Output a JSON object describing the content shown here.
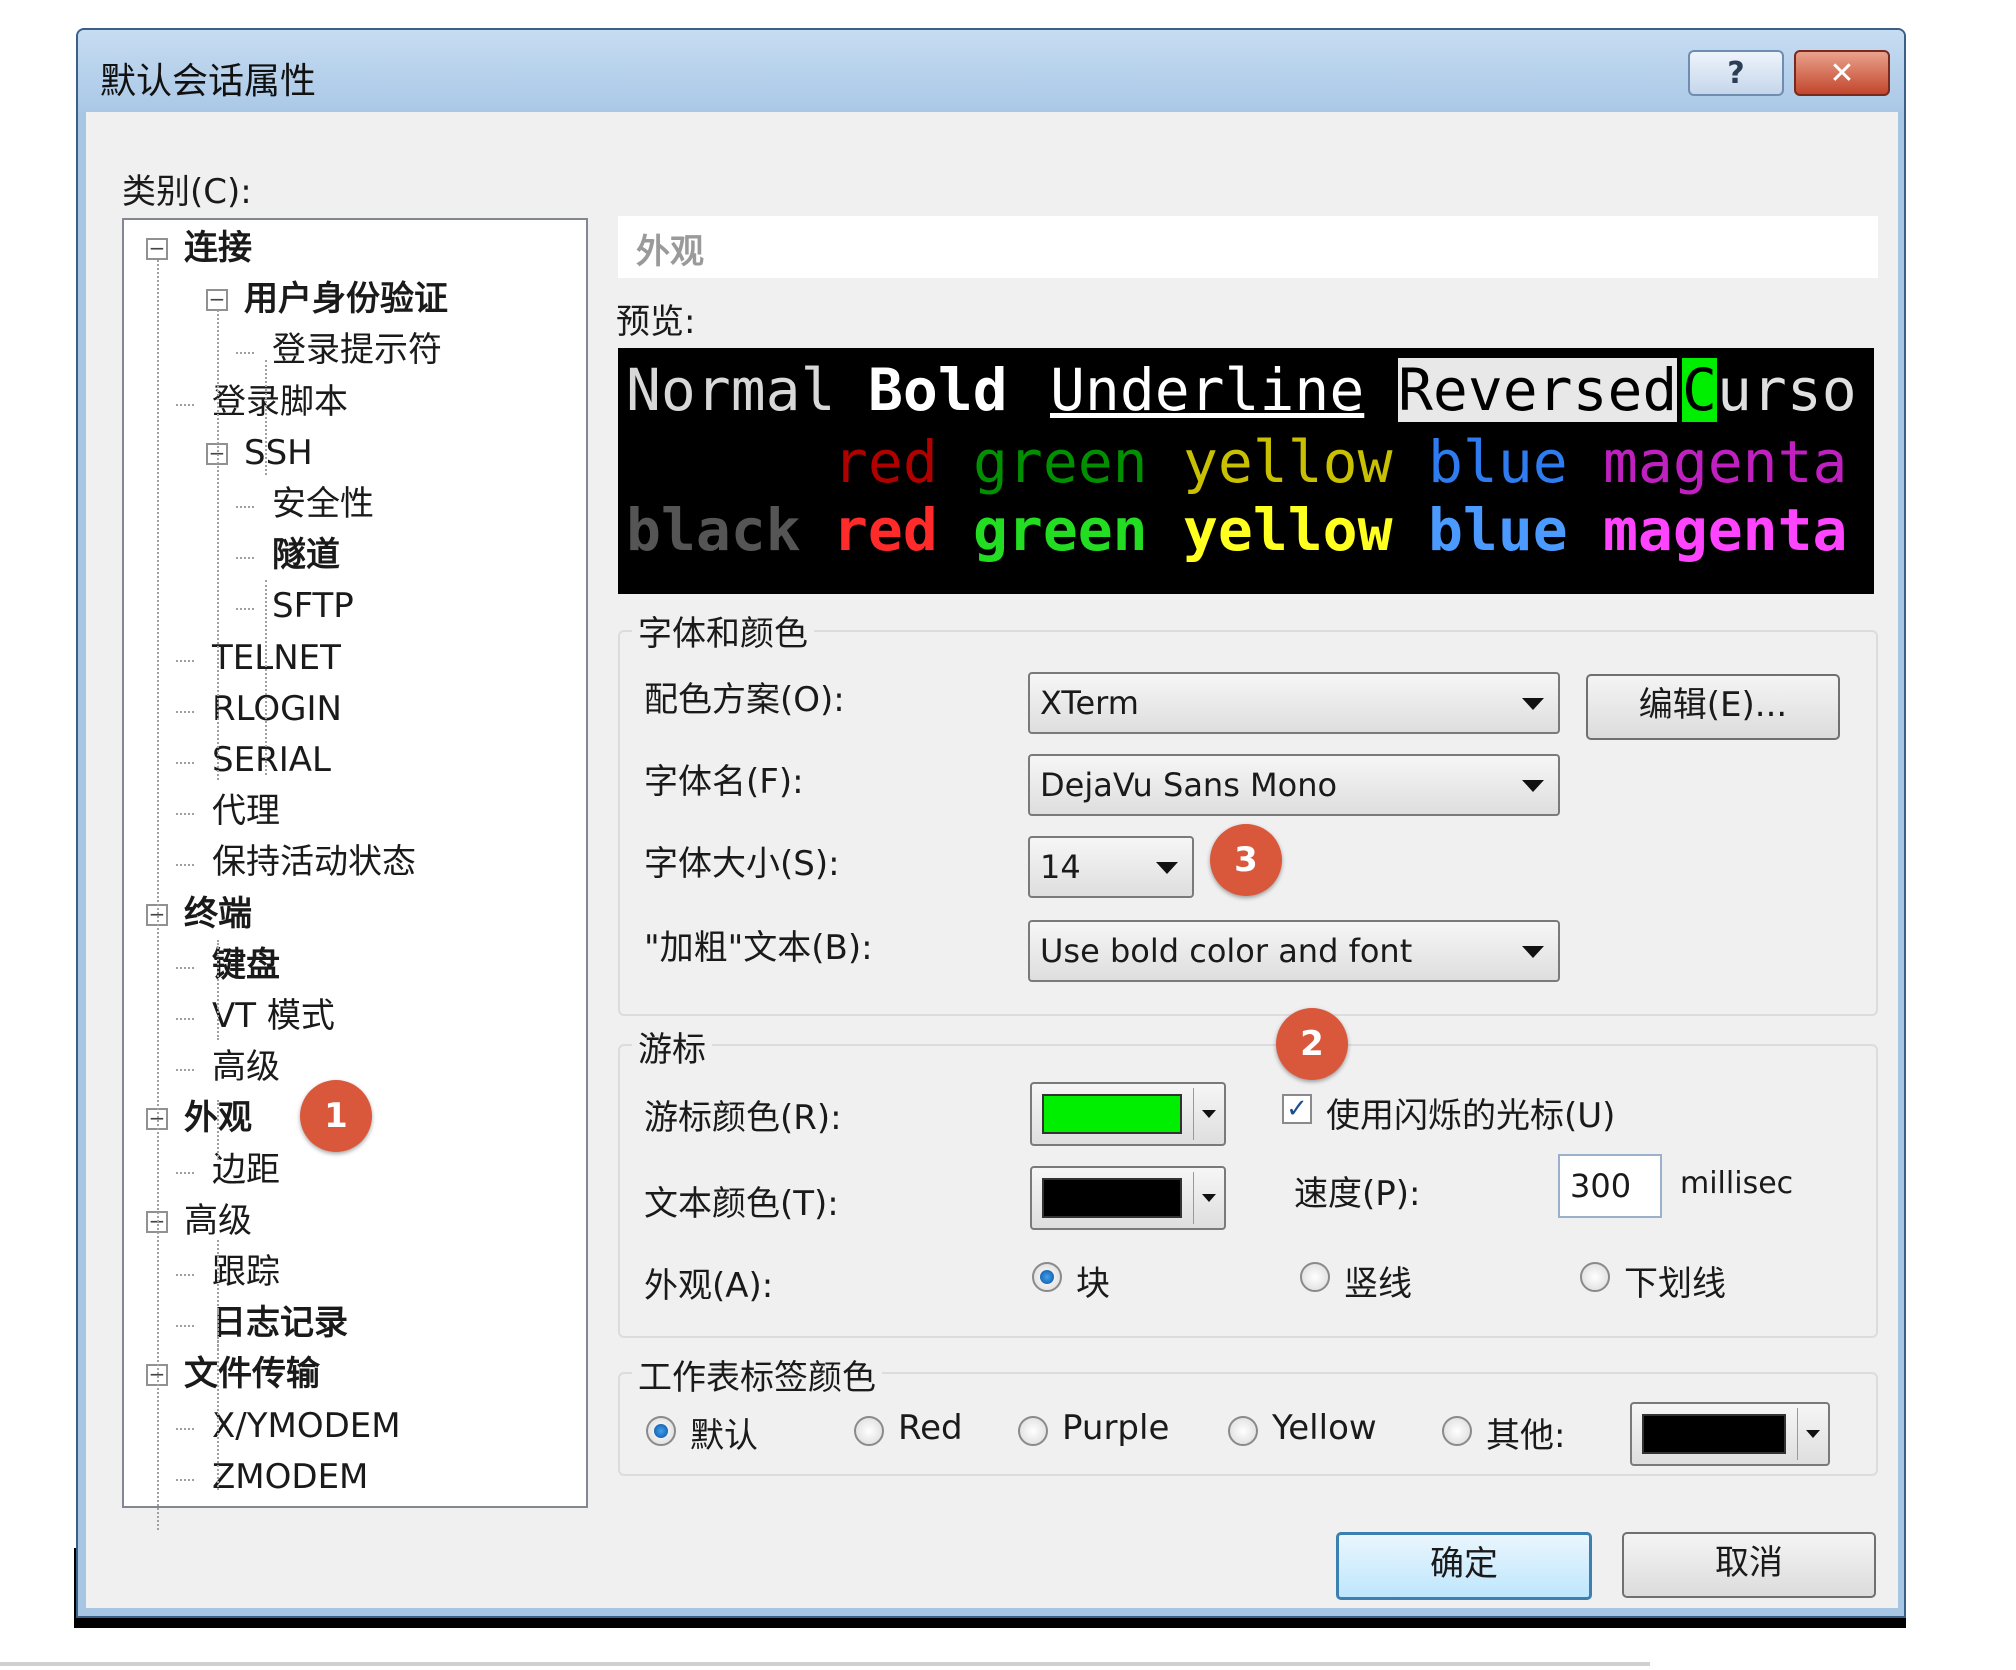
{
  "window": {
    "title": "默认会话属性",
    "help_glyph": "?",
    "close_glyph": "✕"
  },
  "category": {
    "label": "类别(C):",
    "tree": [
      {
        "label": "连接",
        "bold": true,
        "expander": "⊟"
      },
      {
        "label": "用户身份验证",
        "bold": true,
        "expander": "⊟"
      },
      {
        "label": "登录提示符"
      },
      {
        "label": "登录脚本"
      },
      {
        "label": "SSH",
        "expander": "⊟"
      },
      {
        "label": "安全性"
      },
      {
        "label": "隧道",
        "bold": true
      },
      {
        "label": "SFTP"
      },
      {
        "label": "TELNET"
      },
      {
        "label": "RLOGIN"
      },
      {
        "label": "SERIAL"
      },
      {
        "label": "代理"
      },
      {
        "label": "保持活动状态"
      },
      {
        "label": "终端",
        "bold": true,
        "expander": "⊟"
      },
      {
        "label": "键盘",
        "bold": true
      },
      {
        "label": "VT 模式"
      },
      {
        "label": "高级"
      },
      {
        "label": "外观",
        "bold": true,
        "expander": "⊟",
        "selected": true
      },
      {
        "label": "边距"
      },
      {
        "label": "高级",
        "expander": "⊟"
      },
      {
        "label": "跟踪"
      },
      {
        "label": "日志记录",
        "bold": true
      },
      {
        "label": "文件传输",
        "bold": true,
        "expander": "⊟"
      },
      {
        "label": "X/YMODEM"
      },
      {
        "label": "ZMODEM"
      }
    ]
  },
  "page": {
    "title": "外观",
    "preview_label": "预览:",
    "preview": {
      "line1": [
        "Normal",
        "Bold",
        "Underline",
        "Reversed",
        "C",
        "urso"
      ],
      "line2": [
        "red",
        "green",
        "yellow",
        "blue",
        "magenta"
      ],
      "line3": [
        "black",
        "red",
        "green",
        "yellow",
        "blue",
        "magenta"
      ]
    }
  },
  "font_group": {
    "legend": "字体和颜色",
    "scheme_label": "配色方案(O):",
    "scheme_value": "XTerm",
    "edit_button": "编辑(E)...",
    "font_label": "字体名(F):",
    "font_value": "DejaVu Sans Mono",
    "size_label": "字体大小(S):",
    "size_value": "14",
    "bold_label": "\"加粗\"文本(B):",
    "bold_value": "Use bold color and font"
  },
  "cursor_group": {
    "legend": "游标",
    "cursor_color_label": "游标颜色(R):",
    "cursor_color": "#00ee00",
    "text_color_label": "文本颜色(T):",
    "text_color": "#000000",
    "blink_label": "使用闪烁的光标(U)",
    "blink_checked": true,
    "check_glyph": "✓",
    "speed_label": "速度(P):",
    "speed_value": "300",
    "speed_unit": "millisec",
    "appearance_label": "外观(A):",
    "appearance_options": [
      "块",
      "竖线",
      "下划线"
    ],
    "appearance_selected": "块"
  },
  "tab_group": {
    "legend": "工作表标签颜色",
    "options": [
      "默认",
      "Red",
      "Purple",
      "Yellow",
      "其他:"
    ],
    "selected": "默认",
    "other_color": "#000000"
  },
  "buttons": {
    "ok": "确定",
    "cancel": "取消"
  },
  "annotations": [
    "1",
    "2",
    "3"
  ],
  "colors": {
    "accent_badge": "#d9583b",
    "preview_bg": "#000000",
    "red": "#e01010",
    "green": "#22cc22",
    "yellow": "#e8e800",
    "blue": "#3a8cff",
    "magenta": "#e030e0",
    "black_text": "#555555"
  }
}
